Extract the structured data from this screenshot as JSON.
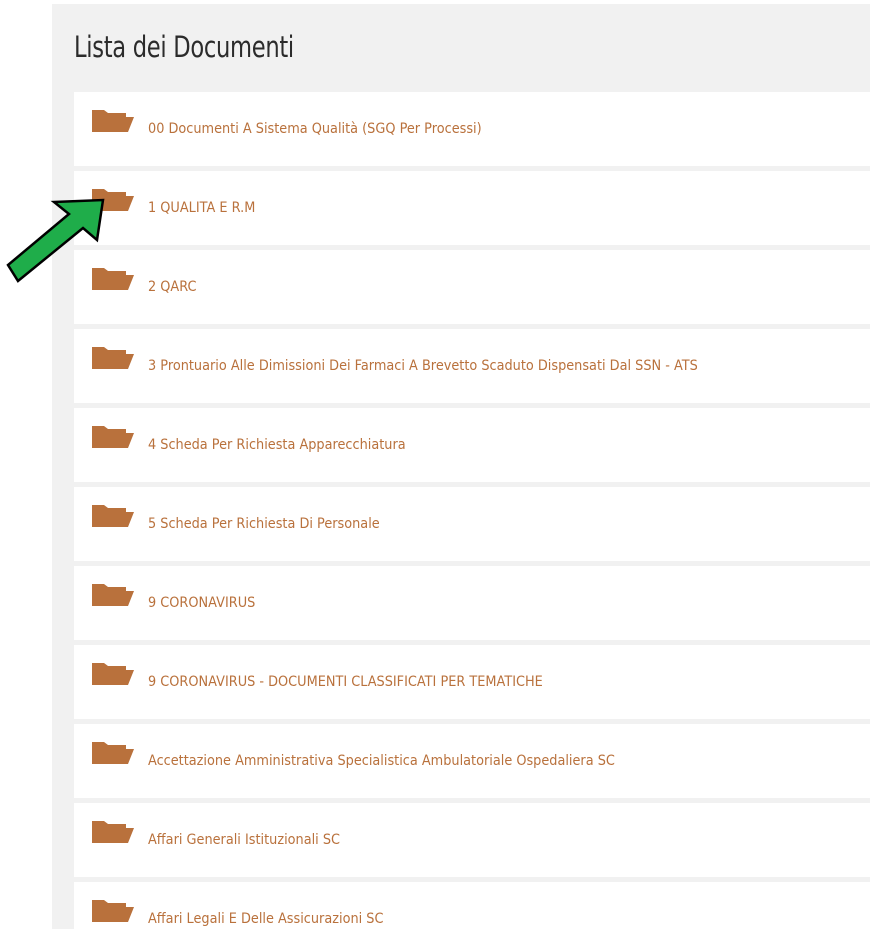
{
  "title": "Lista dei Documenti",
  "colors": {
    "folder": "#b9713c",
    "link_text": "#b9713c",
    "panel_bg": "#f1f1f1",
    "arrow_fill": "#1fad4a"
  },
  "icons": {
    "folder": "folder-open-icon",
    "annotation": "green-arrow-icon"
  },
  "documents": [
    {
      "label": "00 Documenti A Sistema Qualità (SGQ Per Processi)"
    },
    {
      "label": "1 QUALITA E R.M"
    },
    {
      "label": "2 QARC"
    },
    {
      "label": "3 Prontuario Alle Dimissioni Dei Farmaci A Brevetto Scaduto Dispensati Dal SSN - ATS"
    },
    {
      "label": "4 Scheda Per Richiesta Apparecchiatura"
    },
    {
      "label": "5 Scheda Per Richiesta Di Personale"
    },
    {
      "label": "9 CORONAVIRUS"
    },
    {
      "label": "9 CORONAVIRUS - DOCUMENTI CLASSIFICATI PER TEMATICHE"
    },
    {
      "label": "Accettazione Amministrativa Specialistica Ambulatoriale Ospedaliera SC"
    },
    {
      "label": "Affari Generali Istituzionali SC"
    },
    {
      "label": "Affari Legali E Delle Assicurazioni SC"
    }
  ]
}
